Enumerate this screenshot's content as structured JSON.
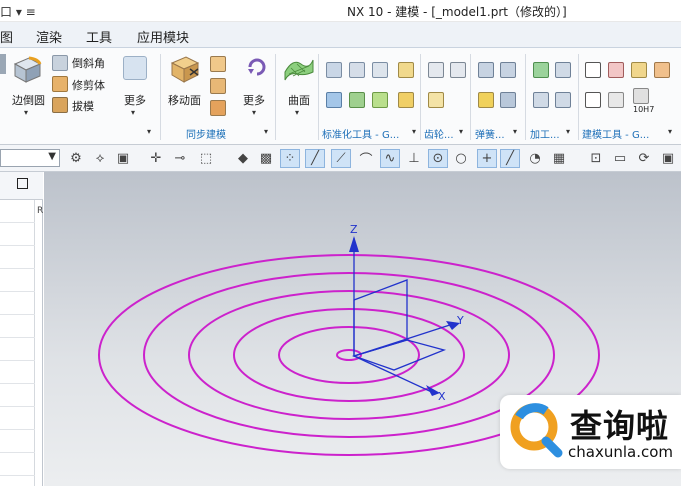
{
  "titlebar": {
    "quick_access": "口 ▾ ≡",
    "title": "NX 10 - 建模 - [_model1.prt（修改的）]"
  },
  "menu": {
    "items": [
      "图",
      "渲染",
      "工具",
      "应用模块"
    ]
  },
  "ribbon": {
    "edge_fillet": "边倒圆",
    "chamfer": "倒斜角",
    "trim_body": "修剪体",
    "draft": "拔模",
    "more": "更多",
    "move_face": "移动面",
    "more2": "更多",
    "surface": "曲面",
    "sync_modeling": "同步建模",
    "std_tools": "标准化工具 - G...",
    "gear": "齿轮...",
    "spring": "弹簧...",
    "machining": "加工...",
    "build_tools": "建模工具 - G...",
    "tolerance": "10H7"
  },
  "watermark": {
    "title": "查询啦",
    "url": "chaxunla.com"
  },
  "viewport": {
    "axis_z": "Z",
    "axis_y": "Y",
    "axis_x": "X",
    "spiral_color": "#cc22cc",
    "axis_color": "#2233cc"
  }
}
